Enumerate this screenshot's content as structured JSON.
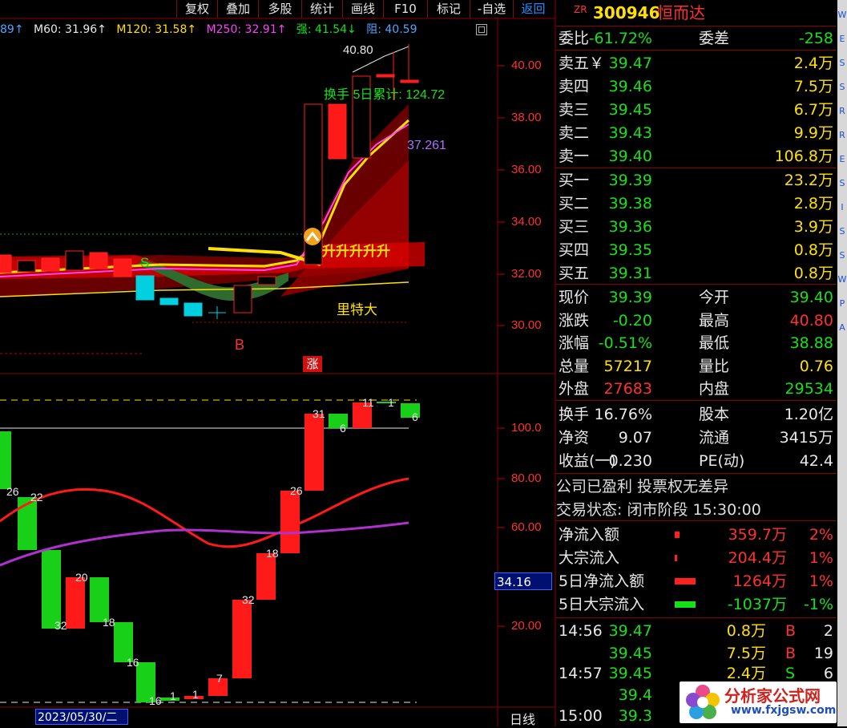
{
  "toolbar": {
    "items": [
      "复权",
      "叠加",
      "多股",
      "统计",
      "画线",
      "F10",
      "标记",
      "-自选",
      "返回"
    ],
    "active": "返回"
  },
  "indicators": {
    "m_prev": "89↑",
    "m60": "M60: 31.96↑",
    "m120": "M120: 31.58↑",
    "m250": "M250: 32.91↑",
    "qiang": "强: 41.54↓",
    "zu": "阻: 40.59"
  },
  "chart_annotations": {
    "peak": "40.80",
    "turnover": "换手 5日累计: 124.72",
    "ma_value": "37.261",
    "breakout": "升升升升升",
    "lite_da": "里特大",
    "signal_s": "S",
    "signal_b": "B",
    "zhang": "涨",
    "date": "2023/05/30/二",
    "lower_value": "34.16",
    "bottom_tab": "日线"
  },
  "price_axis": {
    "labels": [
      "40.00",
      "38.00",
      "36.00",
      "34.00",
      "32.00",
      "30.00"
    ]
  },
  "osc_axis": {
    "labels": [
      "100.0",
      "80.00",
      "60.00",
      "20.00"
    ]
  },
  "osc_bar_labels": [
    "26",
    "22",
    "32",
    "20",
    "18",
    "16",
    "16",
    "1",
    "1",
    "7",
    "32",
    "18",
    "26",
    "31",
    "6",
    "11",
    "1",
    "6"
  ],
  "stock": {
    "code": "300946",
    "name": "恒而达",
    "badge": "ZR"
  },
  "orderbook": {
    "weibi_label": "委比",
    "weibi_value": "-61.72%",
    "weicha_label": "委差",
    "weicha_value": "-258",
    "asks": [
      {
        "label": "卖五￥",
        "price": "39.47",
        "vol": "2.4万"
      },
      {
        "label": "卖四",
        "price": "39.46",
        "vol": "7.5万"
      },
      {
        "label": "卖三",
        "price": "39.45",
        "vol": "6.7万"
      },
      {
        "label": "卖二",
        "price": "39.43",
        "vol": "9.9万"
      },
      {
        "label": "卖一",
        "price": "39.40",
        "vol": "106.8万"
      }
    ],
    "bids": [
      {
        "label": "买一",
        "price": "39.39",
        "vol": "23.2万"
      },
      {
        "label": "买二",
        "price": "39.38",
        "vol": "2.8万"
      },
      {
        "label": "买三",
        "price": "39.36",
        "vol": "3.9万"
      },
      {
        "label": "买四",
        "price": "39.35",
        "vol": "0.8万"
      },
      {
        "label": "买五",
        "price": "39.31",
        "vol": "0.8万"
      }
    ]
  },
  "quote": [
    {
      "l1": "现价",
      "v1": "39.39",
      "l2": "今开",
      "v2": "39.40",
      "c1": "g",
      "c2": "g"
    },
    {
      "l1": "涨跌",
      "v1": "-0.20",
      "l2": "最高",
      "v2": "40.80",
      "c1": "g",
      "c2": "r"
    },
    {
      "l1": "涨幅",
      "v1": "-0.51%",
      "l2": "最低",
      "v2": "38.88",
      "c1": "g",
      "c2": "g"
    },
    {
      "l1": "总量",
      "v1": "57217",
      "l2": "量比",
      "v2": "0.76",
      "c1": "y",
      "c2": "y"
    },
    {
      "l1": "外盘",
      "v1": "27683",
      "l2": "内盘",
      "v2": "29534",
      "c1": "r",
      "c2": "g"
    }
  ],
  "fund": [
    {
      "l1": "换手",
      "v1": "16.76%",
      "l2": "股本",
      "v2": "1.20亿"
    },
    {
      "l1": "净资",
      "v1": "9.07",
      "l2": "流通",
      "v2": "3415万"
    },
    {
      "l1": "收益(一)",
      "v1": "0.230",
      "l2": "PE(动)",
      "v2": "42.4"
    }
  ],
  "company_note": "公司已盈利 投票权无差异",
  "trade_status": "交易状态: 闭市阶段 15:30:00",
  "flows": [
    {
      "label": "净流入额",
      "value": "359.7万",
      "pct": "2%"
    },
    {
      "label": "大宗流入",
      "value": "204.4万",
      "pct": "1%"
    },
    {
      "label": "5日净流入额",
      "value": "1264万",
      "pct": "1%"
    },
    {
      "label": "5日大宗流入",
      "value": "-1037万",
      "pct": "-1%"
    }
  ],
  "ticks": [
    {
      "time": "14:56",
      "price": "39.47",
      "vol": "0.8万",
      "bs": "B",
      "n": "2",
      "pc": "g",
      "bc": "r"
    },
    {
      "time": "",
      "price": "39.45",
      "vol": "7.5万",
      "bs": "B",
      "n": "19",
      "pc": "g",
      "bc": "r"
    },
    {
      "time": "14:57",
      "price": "39.45",
      "vol": "2.4万",
      "bs": "S",
      "n": "6",
      "pc": "g",
      "bc": "g"
    },
    {
      "time": "",
      "price": "39.4",
      "vol": "",
      "bs": "",
      "n": "",
      "pc": "g",
      "bc": "g"
    },
    {
      "time": "15:00",
      "price": "39.3",
      "vol": "",
      "bs": "",
      "n": "",
      "pc": "g",
      "bc": "g"
    }
  ],
  "logo": {
    "title": "分析家公式网",
    "url": "www.fxjgsw.com"
  },
  "scroll_marks": [
    "W",
    "E",
    "S",
    "S",
    "R",
    "R",
    "E",
    "S",
    "I",
    "S",
    "S",
    "W",
    "P",
    "A"
  ]
}
